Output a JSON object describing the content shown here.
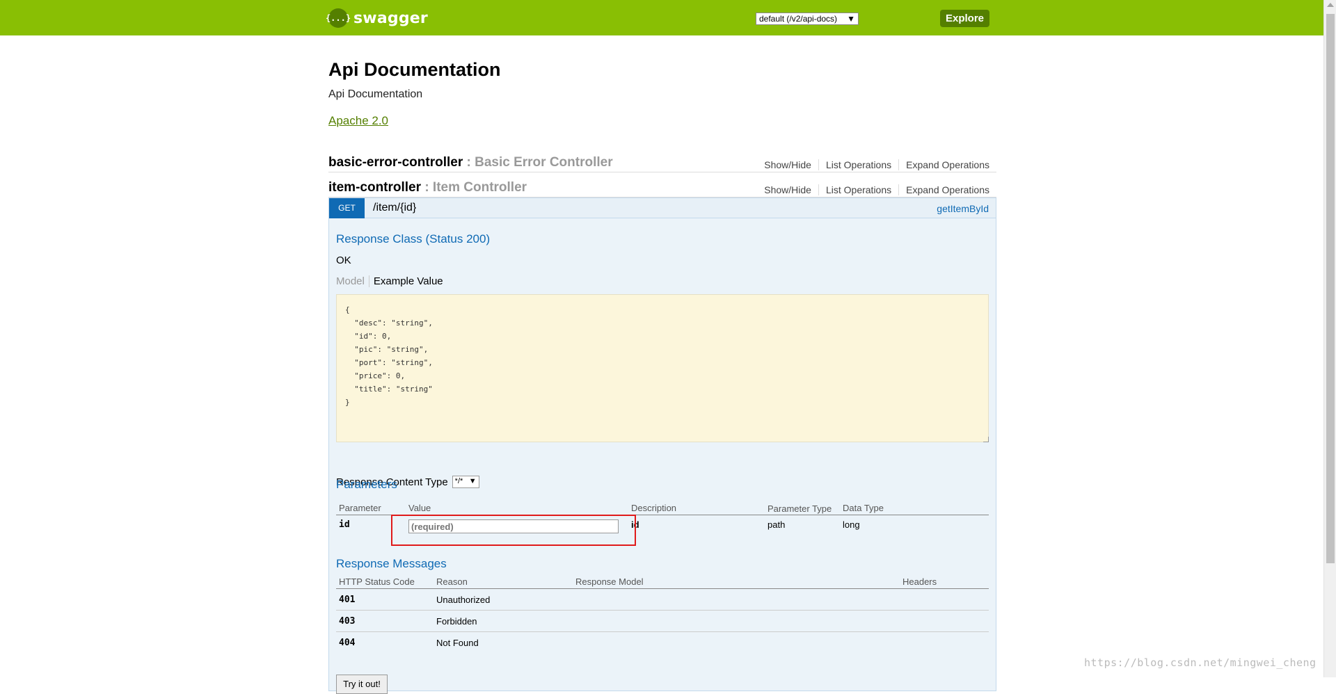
{
  "header": {
    "logo_glyph": "{...}",
    "logo_text": "swagger",
    "spec_select_value": "default (/v2/api-docs)",
    "explore_label": "Explore",
    "bar_color": "#89bf04"
  },
  "info": {
    "title": "Api Documentation",
    "description": "Api Documentation",
    "license": "Apache 2.0"
  },
  "resources": [
    {
      "name": "basic-error-controller",
      "desc": ": Basic Error Controller",
      "show_hide": "Show/Hide",
      "list_ops": "List Operations",
      "expand_ops": "Expand Operations"
    },
    {
      "name": "item-controller",
      "desc": ": Item Controller",
      "show_hide": "Show/Hide",
      "list_ops": "List Operations",
      "expand_ops": "Expand Operations"
    }
  ],
  "operation": {
    "method": "GET",
    "method_color": "#0f6ab4",
    "path": "/item/{id}",
    "nickname": "getItemById",
    "response_class_title": "Response Class (Status 200)",
    "response_class_value": "OK",
    "tab_model": "Model",
    "tab_example": "Example Value",
    "example_value": "{\n  \"desc\": \"string\",\n  \"id\": 0,\n  \"pic\": \"string\",\n  \"port\": \"string\",\n  \"price\": 0,\n  \"title\": \"string\"\n}",
    "response_content_type_label": "Response Content Type",
    "response_content_type_value": "*/*",
    "parameters_title": "Parameters",
    "param_headers": {
      "parameter": "Parameter",
      "value": "Value",
      "description": "Description",
      "param_type": "Parameter Type",
      "data_type": "Data Type"
    },
    "params": [
      {
        "name": "id",
        "placeholder": "(required)",
        "description": "id",
        "param_type": "path",
        "data_type": "long"
      }
    ],
    "response_messages_title": "Response Messages",
    "resp_headers": {
      "status": "HTTP Status Code",
      "reason": "Reason",
      "model": "Response Model",
      "headers": "Headers"
    },
    "responses": [
      {
        "code": "401",
        "reason": "Unauthorized"
      },
      {
        "code": "403",
        "reason": "Forbidden"
      },
      {
        "code": "404",
        "reason": "Not Found"
      }
    ],
    "try_button": "Try it out!"
  },
  "watermark": "https://blog.csdn.net/mingwei_cheng"
}
